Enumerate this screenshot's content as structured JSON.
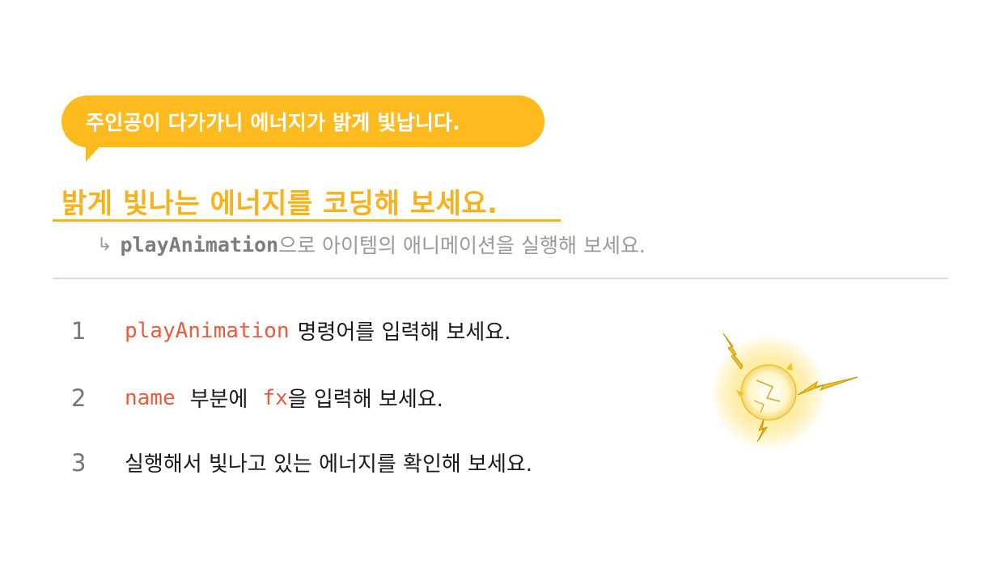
{
  "bubble": {
    "text": "주인공이 다가가니 에너지가 밝게 빛납니다."
  },
  "title": "밝게 빛나는 에너지를 코딩해 보세요.",
  "hint": {
    "arrow": "↳",
    "code": "playAnimation",
    "text": "으로 아이템의 애니메이션을 실행해 보세요."
  },
  "steps": [
    {
      "number": "1",
      "code": "playAnimation",
      "text": "명령어를 입력해 보세요."
    },
    {
      "number": "2",
      "code": "name",
      "text_mid": "부분에",
      "code2": "fx",
      "text": "을 입력해 보세요."
    },
    {
      "number": "3",
      "text": "실행해서 빛나고 있는 에너지를 확인해 보세요."
    }
  ],
  "colors": {
    "accent": "#fdbb1f",
    "title": "#f7b21b",
    "code": "#ee5a3c",
    "muted": "#9a9a9a",
    "divider": "#dcdcdc"
  },
  "illustration": {
    "icon": "glowing-energy-orb-icon"
  }
}
